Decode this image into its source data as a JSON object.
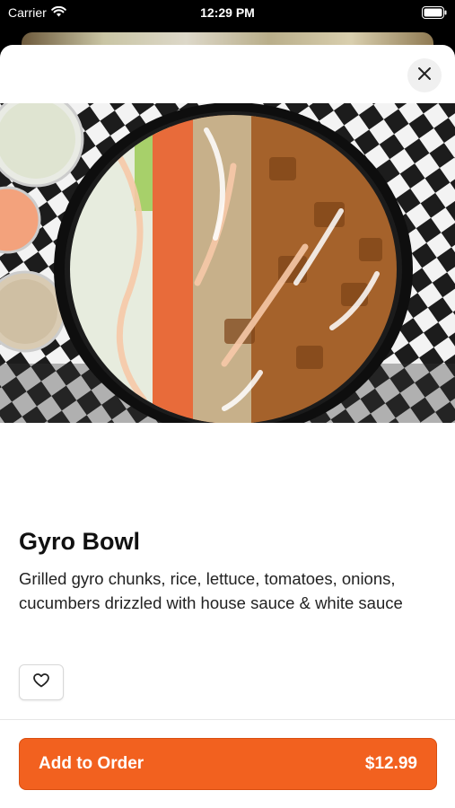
{
  "status_bar": {
    "carrier": "Carrier",
    "time": "12:29 PM"
  },
  "product": {
    "name": "Gyro Bowl",
    "description": "Grilled gyro chunks, rice, lettuce, tomatoes, onions, cucumbers drizzled with house sauce & white sauce",
    "image_alt": "Gyro bowl with toppings"
  },
  "actions": {
    "add_label": "Add to Order",
    "price": "$12.99"
  },
  "icons": {
    "close": "close-icon",
    "favorite": "heart-icon",
    "wifi": "wifi-icon",
    "battery": "battery-icon"
  },
  "colors": {
    "accent": "#f2611f"
  }
}
